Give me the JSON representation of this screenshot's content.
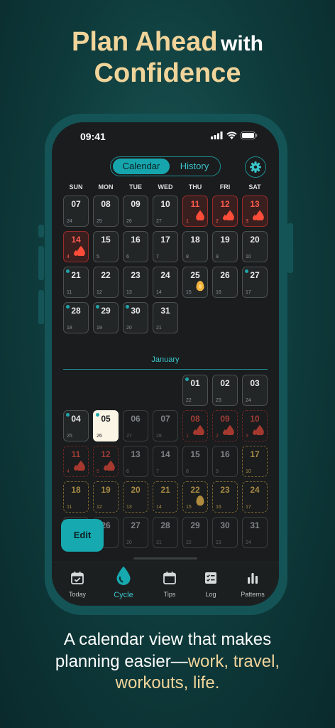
{
  "headline": {
    "line1": "Plan Ahead",
    "with": "with",
    "line2": "Confidence"
  },
  "caption": {
    "part1": "A calendar view that makes",
    "part2": "planning easier—",
    "gold1": "work, travel,",
    "gold2": "workouts, life."
  },
  "status": {
    "time": "09:41"
  },
  "segmented": {
    "calendar": "Calendar",
    "history": "History",
    "active": "Calendar"
  },
  "weekdays": [
    "SUN",
    "MON",
    "TUE",
    "WED",
    "THU",
    "FRI",
    "SAT"
  ],
  "colors": {
    "teal": "#17a5ad",
    "period": "#ff5b4d",
    "fertile": "#f3c25e",
    "today_bg": "#fbf5e6"
  },
  "month1": {
    "weeks": [
      [
        {
          "d": "07",
          "c": "24",
          "t": "normal"
        },
        {
          "d": "08",
          "c": "25",
          "t": "normal"
        },
        {
          "d": "09",
          "c": "26",
          "t": "normal"
        },
        {
          "d": "10",
          "c": "27",
          "t": "normal"
        },
        {
          "d": "11",
          "c": "1",
          "t": "period",
          "icon": "drop"
        },
        {
          "d": "12",
          "c": "2",
          "t": "period",
          "icon": "drops"
        },
        {
          "d": "13",
          "c": "3",
          "t": "period",
          "icon": "drops"
        }
      ],
      [
        {
          "d": "14",
          "c": "4",
          "t": "period",
          "icon": "drops"
        },
        {
          "d": "15",
          "c": "5",
          "t": "normal"
        },
        {
          "d": "16",
          "c": "6",
          "t": "normal"
        },
        {
          "d": "17",
          "c": "7",
          "t": "normal"
        },
        {
          "d": "18",
          "c": "8",
          "t": "normal"
        },
        {
          "d": "19",
          "c": "9",
          "t": "normal"
        },
        {
          "d": "20",
          "c": "10",
          "t": "fertile"
        }
      ],
      [
        {
          "d": "21",
          "c": "11",
          "t": "fertile",
          "dot": true
        },
        {
          "d": "22",
          "c": "12",
          "t": "fertile"
        },
        {
          "d": "23",
          "c": "13",
          "t": "fertile"
        },
        {
          "d": "24",
          "c": "14",
          "t": "fertile"
        },
        {
          "d": "25",
          "c": "15",
          "t": "fertile",
          "icon": "egg"
        },
        {
          "d": "26",
          "c": "16",
          "t": "fertile"
        },
        {
          "d": "27",
          "c": "17",
          "t": "fertile",
          "dot": true
        }
      ],
      [
        {
          "d": "28",
          "c": "18",
          "t": "normal",
          "dot": true
        },
        {
          "d": "29",
          "c": "19",
          "t": "normal",
          "dot": true
        },
        {
          "d": "30",
          "c": "20",
          "t": "normal",
          "dot": true
        },
        {
          "d": "31",
          "c": "21",
          "t": "normal"
        },
        null,
        null,
        null
      ]
    ]
  },
  "month2": {
    "name": "January",
    "weeks": [
      [
        null,
        null,
        null,
        null,
        {
          "d": "01",
          "c": "22",
          "t": "normal",
          "dot": true
        },
        {
          "d": "02",
          "c": "23",
          "t": "normal"
        },
        {
          "d": "03",
          "c": "24",
          "t": "normal"
        }
      ],
      [
        {
          "d": "04",
          "c": "25",
          "t": "normal",
          "dot": true
        },
        {
          "d": "05",
          "c": "26",
          "t": "today",
          "dot": true
        },
        {
          "d": "06",
          "c": "27",
          "t": "dim"
        },
        {
          "d": "07",
          "c": "28",
          "t": "dim"
        },
        {
          "d": "08",
          "c": "1",
          "t": "dim-period",
          "icon": "drops"
        },
        {
          "d": "09",
          "c": "2",
          "t": "dim-period",
          "icon": "drops"
        },
        {
          "d": "10",
          "c": "3",
          "t": "dim-period",
          "icon": "drops"
        }
      ],
      [
        {
          "d": "11",
          "c": "4",
          "t": "dim-period",
          "icon": "drops"
        },
        {
          "d": "12",
          "c": "5",
          "t": "dim-period",
          "icon": "drops"
        },
        {
          "d": "13",
          "c": "6",
          "t": "dim"
        },
        {
          "d": "14",
          "c": "7",
          "t": "dim"
        },
        {
          "d": "15",
          "c": "8",
          "t": "dim"
        },
        {
          "d": "16",
          "c": "9",
          "t": "dim"
        },
        {
          "d": "17",
          "c": "10",
          "t": "dim-fert"
        }
      ],
      [
        {
          "d": "18",
          "c": "11",
          "t": "dim-fert"
        },
        {
          "d": "19",
          "c": "12",
          "t": "dim-fert"
        },
        {
          "d": "20",
          "c": "13",
          "t": "dim-fert"
        },
        {
          "d": "21",
          "c": "14",
          "t": "dim-fert"
        },
        {
          "d": "22",
          "c": "15",
          "t": "dim-fert",
          "icon": "egg"
        },
        {
          "d": "23",
          "c": "16",
          "t": "dim-fert"
        },
        {
          "d": "24",
          "c": "17",
          "t": "dim-fert"
        }
      ],
      [
        {
          "d": "25",
          "c": "18",
          "t": "dim"
        },
        {
          "d": "26",
          "c": "19",
          "t": "dim"
        },
        {
          "d": "27",
          "c": "20",
          "t": "dim"
        },
        {
          "d": "28",
          "c": "21",
          "t": "dim"
        },
        {
          "d": "29",
          "c": "22",
          "t": "dim"
        },
        {
          "d": "30",
          "c": "23",
          "t": "dim"
        },
        {
          "d": "31",
          "c": "24",
          "t": "dim"
        }
      ]
    ]
  },
  "edit_label": "Edit",
  "tabs": [
    {
      "label": "Today",
      "icon": "calendar-check-icon"
    },
    {
      "label": "Cycle",
      "icon": "drop-icon",
      "active": true
    },
    {
      "label": "Tips",
      "icon": "calendar-icon"
    },
    {
      "label": "Log",
      "icon": "log-icon"
    },
    {
      "label": "Patterns",
      "icon": "bar-chart-icon"
    }
  ]
}
